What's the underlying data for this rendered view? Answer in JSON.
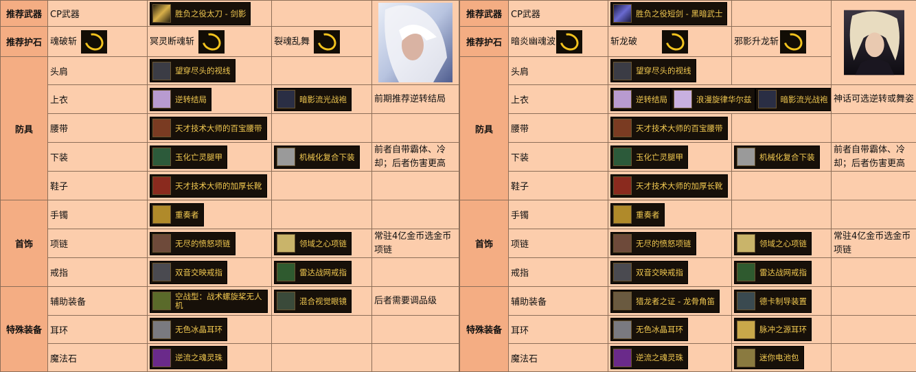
{
  "left": {
    "rec_weapon_label": "推荐武器",
    "weapon_text": "CP武器",
    "weapon_item": "胜负之役太刀 - 剑影",
    "rec_stone_label": "推荐护石",
    "stones": [
      "魂破斩",
      "冥灵断魂斩",
      "裂魂乱舞"
    ],
    "armor_cat": "防具",
    "slots": {
      "shoulder": "头肩",
      "top": "上衣",
      "belt": "腰带",
      "bottom": "下装",
      "shoes": "鞋子",
      "bracelet": "手镯",
      "necklace": "项链",
      "ring": "戒指",
      "support": "辅助装备",
      "earring": "耳环",
      "magicstone": "魔法石"
    },
    "items": {
      "shoulder": "望穿尽头的视线",
      "top": "逆转结局",
      "top2": "暗影流光战袍",
      "belt": "天才技术大师的百宝腰带",
      "bottom": "玉化亡灵腿甲",
      "bottom2": "机械化复合下装",
      "shoes": "天才技术大师的加厚长靴",
      "bracelet": "重奏者",
      "necklace": "无尽的愤怒项链",
      "necklace2": "领域之心项链",
      "ring": "双音交映戒指",
      "ring2": "雷达战网戒指",
      "support": "空战型：战术螺旋桨无人机",
      "support2": "混合视觉眼镜",
      "earring": "无色冰晶耳环",
      "magicstone": "逆流之魂灵珠"
    },
    "notes": {
      "top": "前期推荐逆转结局",
      "bottom": "前者自带霸体、冷却；后者伤害更高",
      "necklace": "常驻4亿金币选金币项链",
      "support": "后者需要调品级"
    },
    "acc_cat": "首饰",
    "special_cat": "特殊装备"
  },
  "right": {
    "rec_weapon_label": "推荐武器",
    "weapon_text": "CP武器",
    "weapon_item": "胜负之役短剑 - 黑暗武士",
    "rec_stone_label": "推荐护石",
    "stones": [
      "暗炎幽魂波",
      "斩龙破",
      "邪影升龙斩"
    ],
    "armor_cat": "防具",
    "slots": {
      "shoulder": "头肩",
      "top": "上衣",
      "belt": "腰带",
      "bottom": "下装",
      "shoes": "鞋子",
      "bracelet": "手镯",
      "necklace": "项链",
      "ring": "戒指",
      "support": "辅助装备",
      "earring": "耳环",
      "magicstone": "魔法石"
    },
    "items": {
      "shoulder": "望穿尽头的视线",
      "top": "逆转结局",
      "top_mid": "浪漫旋律华尔兹",
      "top2": "暗影流光战袍",
      "belt": "天才技术大师的百宝腰带",
      "bottom": "玉化亡灵腿甲",
      "bottom2": "机械化复合下装",
      "shoes": "天才技术大师的加厚长靴",
      "bracelet": "重奏者",
      "necklace": "无尽的愤怒项链",
      "necklace2": "领域之心项链",
      "ring": "双音交映戒指",
      "ring2": "雷达战网戒指",
      "support": "猎龙者之证 - 龙骨角笛",
      "support2": "德卡制导装置",
      "earring": "无色冰晶耳环",
      "earring2": "脉冲之源耳环",
      "magicstone": "逆流之魂灵珠",
      "magicstone2": "迷你电池包"
    },
    "notes": {
      "top": "神话可选逆转或舞姿",
      "bottom": "前者自带霸体、冷却；后者伤害更高",
      "necklace": "常驻4亿金币选金币项链"
    },
    "acc_cat": "首饰",
    "special_cat": "特殊装备"
  }
}
